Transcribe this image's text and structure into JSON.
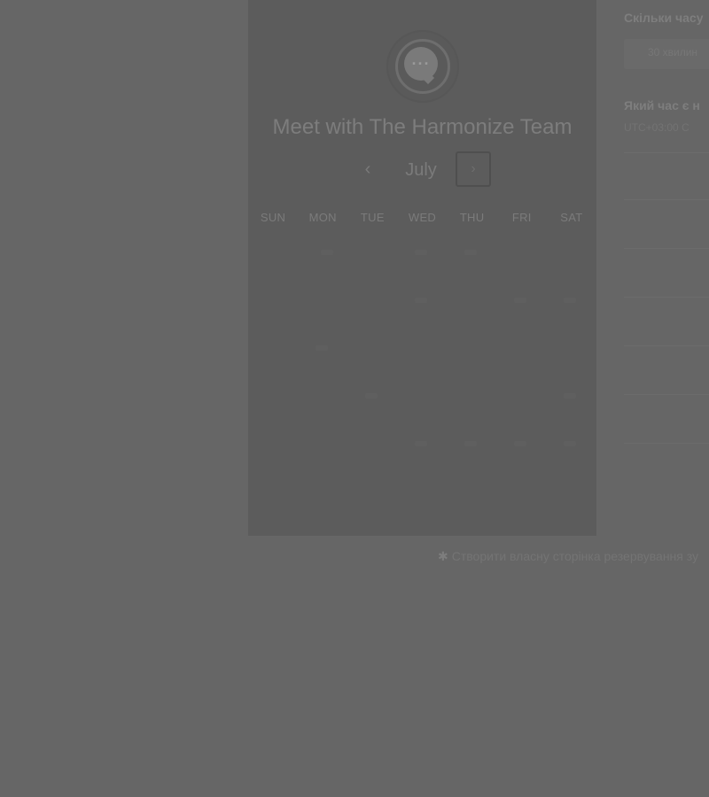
{
  "header": {
    "title": "Meet with The Harmonize Team"
  },
  "avatar": {
    "icon": "chat-bubble-icon",
    "dots": "···"
  },
  "calendar": {
    "month": "July",
    "prev_icon": "‹",
    "next_icon": "›",
    "weekdays": [
      "SUN",
      "MON",
      "TUE",
      "WED",
      "THU",
      "FRI",
      "SAT"
    ]
  },
  "sidebar": {
    "duration_question": "Скільки часу",
    "duration_option": "30 хвилин",
    "time_question": "Який час є н",
    "timezone": "UTC+03:00 С"
  },
  "footer": {
    "icon": "sprocket-icon",
    "link_text": "Створити власну сторінка резервування зу"
  },
  "colors": {
    "overlay": "#666666",
    "panel": "#5c5c5c"
  }
}
